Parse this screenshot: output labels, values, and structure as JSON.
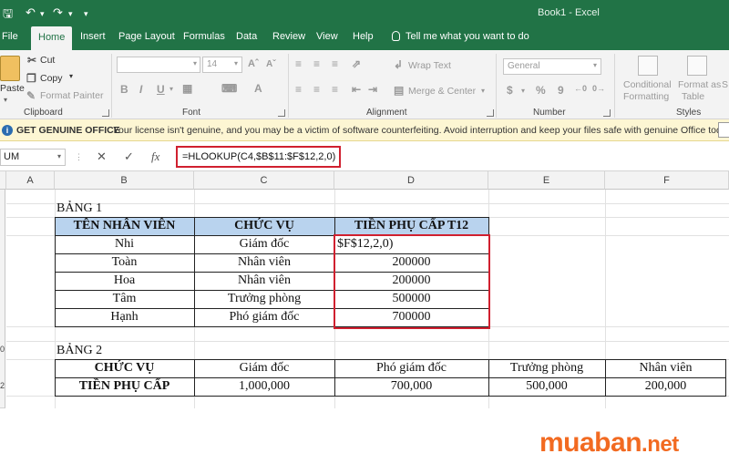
{
  "titlebar": {
    "save_icon": "save-icon",
    "undo_icon": "undo-icon",
    "redo_icon": "redo-icon",
    "title": "Book1  -  Excel"
  },
  "tabs": [
    "File",
    "Home",
    "Insert",
    "Page Layout",
    "Formulas",
    "Data",
    "Review",
    "View",
    "Help"
  ],
  "active_tab": "Home",
  "tell_me": "Tell me what you want to do",
  "ribbon": {
    "clipboard": {
      "paste": "Paste",
      "cut": "Cut",
      "copy": "Copy",
      "format_painter": "Format Painter",
      "label": "Clipboard"
    },
    "font": {
      "font_name": "",
      "font_size": "14",
      "bold": "B",
      "italic": "I",
      "underline": "U",
      "label": "Font"
    },
    "alignment": {
      "wrap_text": "Wrap Text",
      "merge_center": "Merge & Center",
      "label": "Alignment"
    },
    "number": {
      "format": "General",
      "currency": "$",
      "percent": "%",
      "comma": "9",
      "label": "Number"
    },
    "styles": {
      "conditional": "Conditional",
      "conditional2": "Formatting",
      "format_as": "Format as",
      "format_as2": "Table",
      "styles_short": "S",
      "label": "Styles"
    }
  },
  "message_bar": {
    "title": "GET GENUINE OFFICE",
    "text": "Your license isn't genuine, and you may be a victim of software counterfeiting. Avoid interruption and keep your files safe with genuine Office today."
  },
  "formula_bar": {
    "name_box": "UM",
    "cancel": "✕",
    "enter": "✓",
    "fx": "fx",
    "formula": "=HLOOKUP(C4,$B$11:$F$12,2,0)"
  },
  "columns": [
    "A",
    "B",
    "C",
    "D",
    "E",
    "F"
  ],
  "row_numbers": [
    "",
    "",
    "",
    "",
    "",
    "",
    "",
    "",
    "",
    "0",
    "",
    "2"
  ],
  "table1": {
    "caption": "BẢNG 1",
    "headers": [
      "TÊN NHÂN VIÊN",
      "CHỨC VỤ",
      "TIỀN PHỤ CẤP T12"
    ],
    "rows": [
      [
        "Nhi",
        "Giám đốc",
        "$F$12,2,0)"
      ],
      [
        "Toàn",
        "Nhân viên",
        "200000"
      ],
      [
        "Hoa",
        "Nhân viên",
        "200000"
      ],
      [
        "Tâm",
        "Trưởng phòng",
        "500000"
      ],
      [
        "Hạnh",
        "Phó giám đốc",
        "700000"
      ]
    ]
  },
  "table2": {
    "caption": "BẢNG 2",
    "row1": [
      "CHỨC VỤ",
      "Giám đốc",
      "Phó giám đốc",
      "Trưởng phòng",
      "Nhân viên"
    ],
    "row2": [
      "TIỀN PHỤ CẤP",
      "1,000,000",
      "700,000",
      "500,000",
      "200,000"
    ]
  },
  "logo": {
    "main": "muaban",
    "suffix": ".net"
  },
  "colors": {
    "excel_green": "#217346",
    "highlight_red": "#d0202f",
    "header_fill": "#b9d3ee",
    "logo_orange": "#f26a21"
  }
}
